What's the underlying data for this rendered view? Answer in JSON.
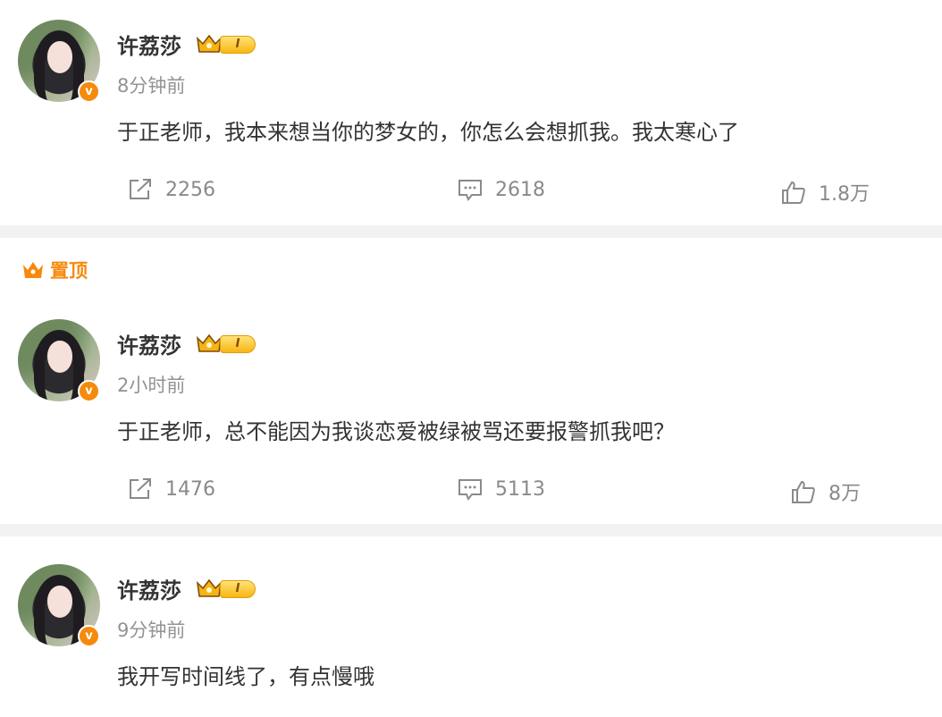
{
  "posts": [
    {
      "author": "许荔莎",
      "level": "I",
      "time": "8分钟前",
      "text": "于正老师，我本来想当你的梦女的，你怎么会想抓我。我太寒心了",
      "reposts": "2256",
      "comments": "2618",
      "likes": "1.8万"
    },
    {
      "author": "许荔莎",
      "level": "I",
      "time": "2小时前",
      "text": "于正老师，总不能因为我谈恋爱被绿被骂还要报警抓我吧？",
      "reposts": "1476",
      "comments": "5113",
      "likes": "8万"
    },
    {
      "author": "许荔莎",
      "level": "I",
      "time": "9分钟前",
      "text": "我开写时间线了，有点慢哦"
    }
  ],
  "pinned_label": "置顶",
  "icons": {
    "repost": "repost-icon",
    "comment": "comment-icon",
    "like": "like-icon",
    "crown": "crown-icon",
    "verified": "verified-badge-icon",
    "pinned": "crown-pin-icon"
  },
  "colors": {
    "accent": "#f68a0d",
    "muted": "#939393",
    "separator": "#f2f2f2"
  }
}
